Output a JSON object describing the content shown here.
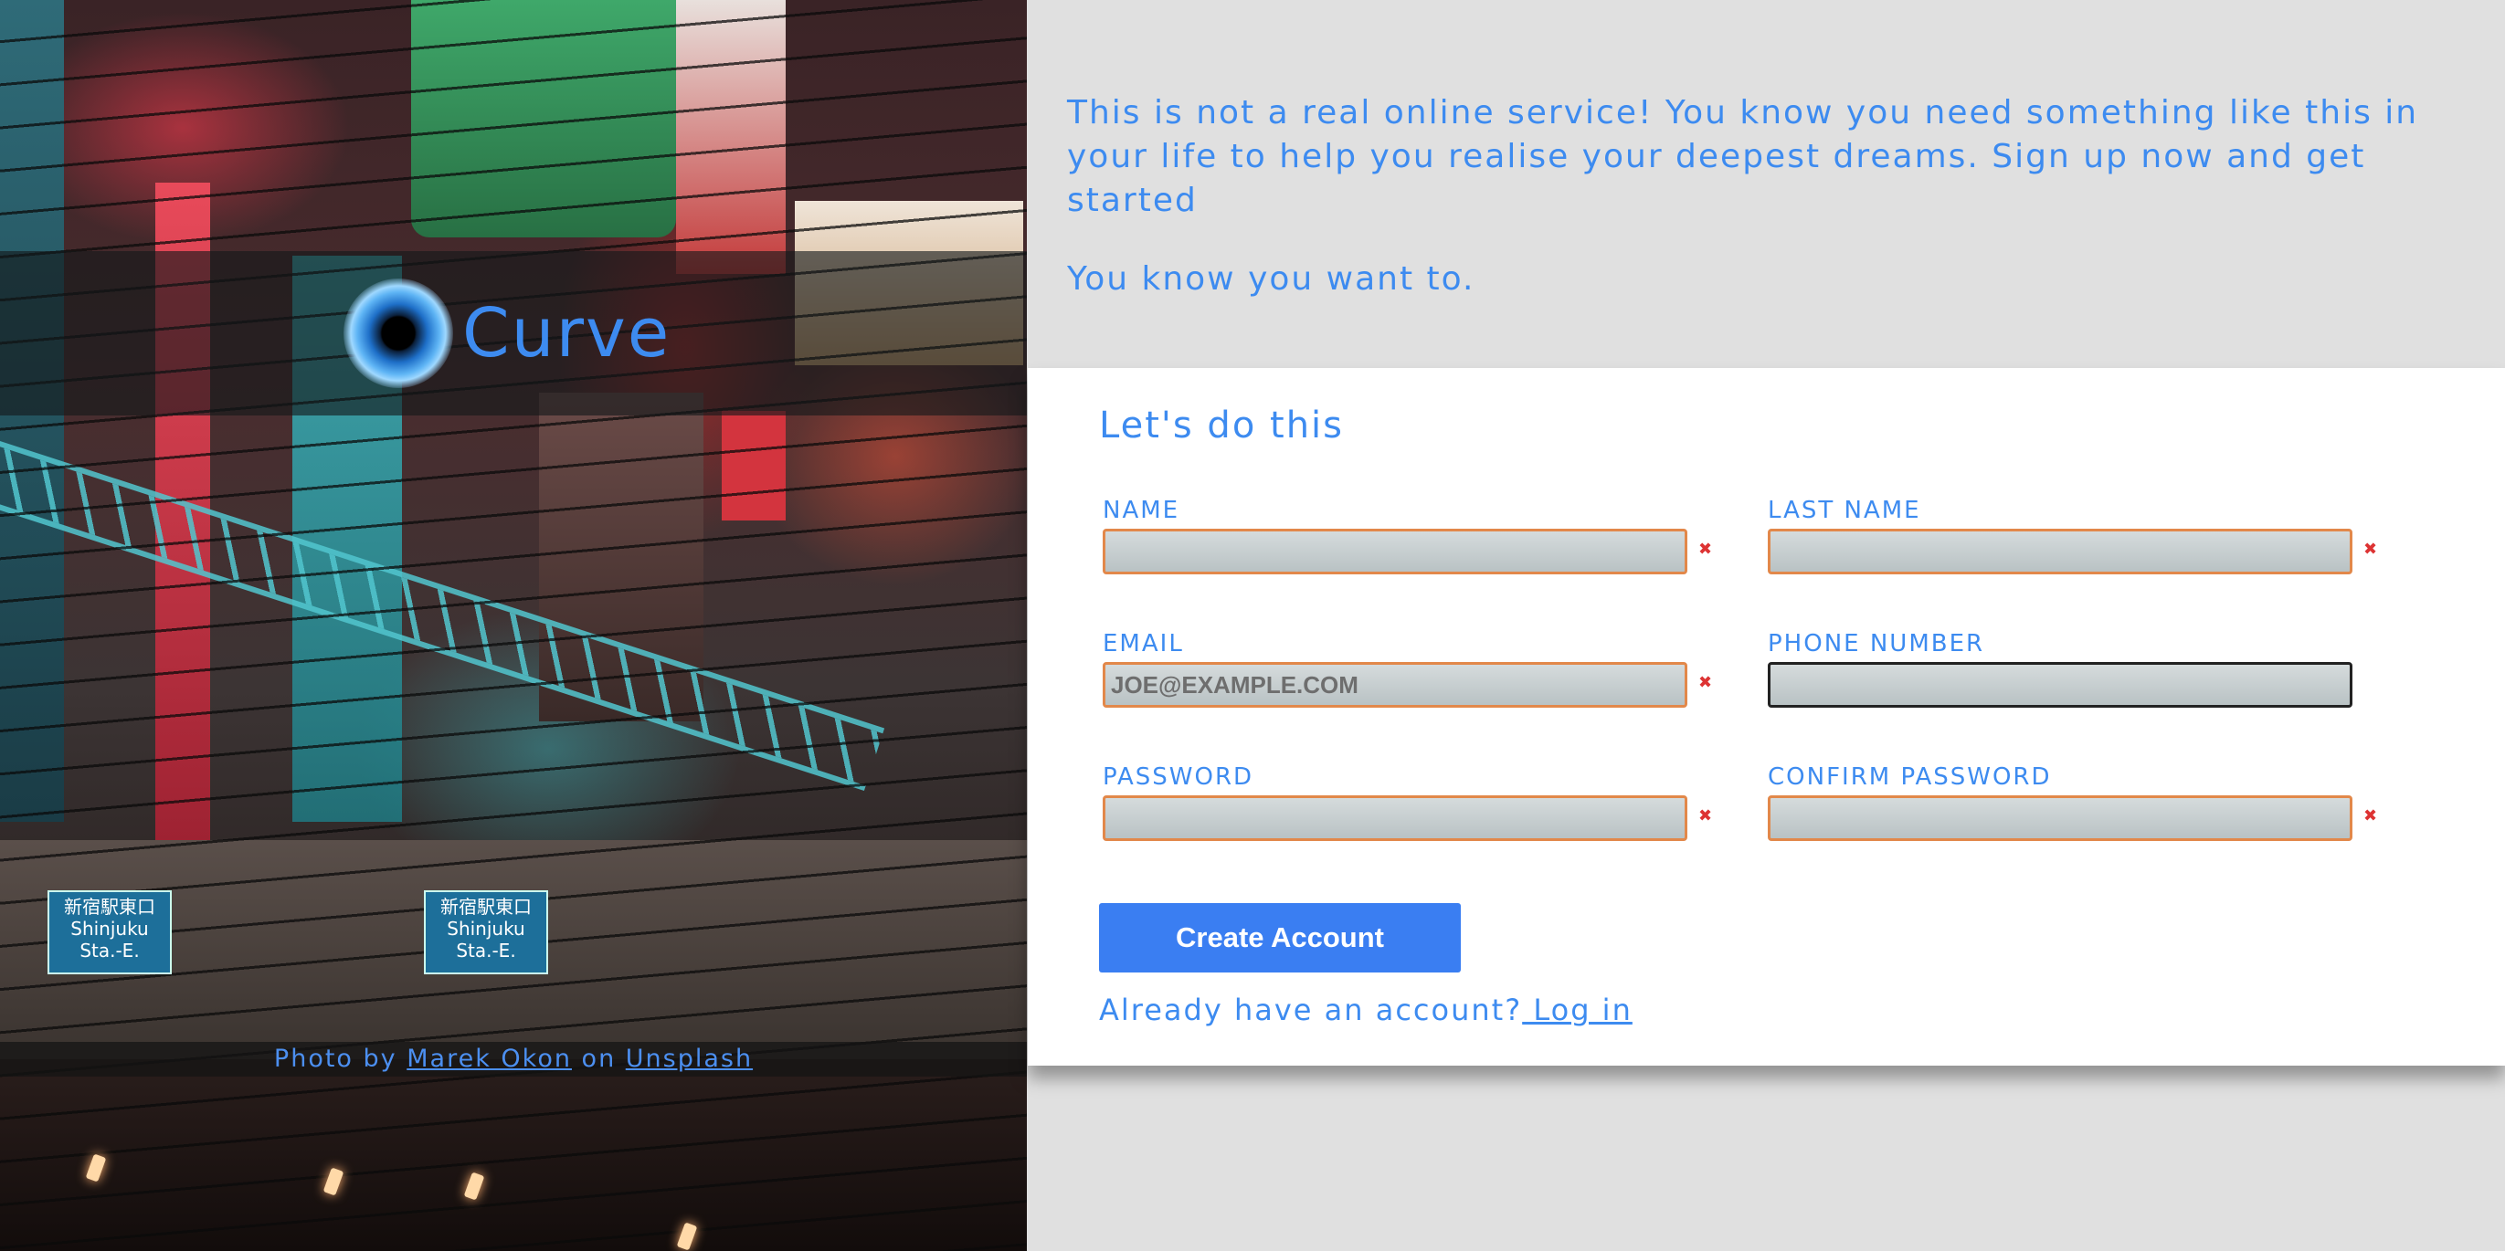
{
  "hero": {
    "logo_text": "Curve",
    "credit_prefix": "Photo by ",
    "credit_author": "Marek Okon",
    "credit_middle": " on ",
    "credit_site": "Unsplash",
    "sign_text": "新宿駅東口 Shinjuku Sta.-E."
  },
  "intro": {
    "paragraph1": "This is not a real online service! You know you need something like this in your life to help you realise your deepest dreams. Sign up now and get started",
    "paragraph2": "You know you want to."
  },
  "form": {
    "title": "Let's do this",
    "fields": {
      "name": {
        "label": "NAME",
        "value": "",
        "placeholder": "",
        "required": true
      },
      "last_name": {
        "label": "LAST NAME",
        "value": "",
        "placeholder": "",
        "required": true
      },
      "email": {
        "label": "EMAIL",
        "value": "",
        "placeholder": "JOE@EXAMPLE.COM",
        "required": true
      },
      "phone": {
        "label": "PHONE NUMBER",
        "value": "",
        "placeholder": "",
        "required": false
      },
      "password": {
        "label": "PASSWORD",
        "value": "",
        "placeholder": "",
        "required": true
      },
      "confirm_password": {
        "label": "CONFIRM PASSWORD",
        "value": "",
        "placeholder": "",
        "required": true
      }
    },
    "required_mark": "✖",
    "submit_label": "Create Account",
    "login_prompt": "Already have an account?",
    "login_link": " Log in"
  },
  "colors": {
    "accent": "#3d8bf0",
    "button": "#3a7ef2",
    "input_border_required": "#e2884a",
    "page_background": "#e0e0e0"
  },
  "icons": {
    "logo": "eye-icon",
    "required": "required-x-icon"
  }
}
